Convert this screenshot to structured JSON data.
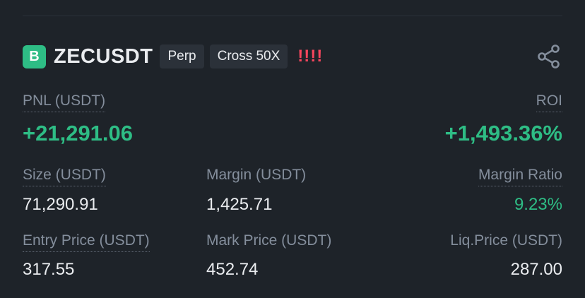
{
  "header": {
    "badge_letter": "B",
    "symbol": "ZECUSDT",
    "tags": [
      "Perp",
      "Cross 50X"
    ],
    "risk_marks": "!!!!",
    "share_icon": "share-icon"
  },
  "pnl": {
    "label": "PNL (USDT)",
    "value": "+21,291.06"
  },
  "roi": {
    "label": "ROI",
    "value": "+1,493.36%"
  },
  "stats_row1": {
    "size_label": "Size (USDT)",
    "size_value": "71,290.91",
    "margin_label": "Margin (USDT)",
    "margin_value": "1,425.71",
    "margin_ratio_label": "Margin Ratio",
    "margin_ratio_value": "9.23%"
  },
  "stats_row2": {
    "entry_label": "Entry Price (USDT)",
    "entry_value": "317.55",
    "mark_label": "Mark Price (USDT)",
    "mark_value": "452.74",
    "liq_label": "Liq.Price (USDT)",
    "liq_value": "287.00"
  },
  "colors": {
    "background": "#1e2329",
    "positive": "#2ebd85",
    "warning": "#f6465d",
    "muted": "#848e9c",
    "text": "#eaecef"
  }
}
